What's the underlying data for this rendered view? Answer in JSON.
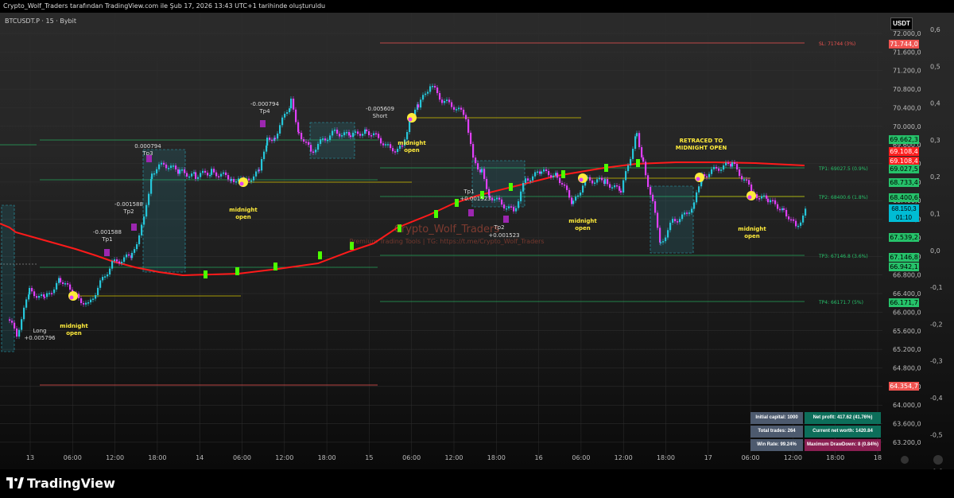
{
  "header": {
    "title": "Crypto_Wolf_Traders tarafından TradingView.com ile Şub 17, 2026 13:43 UTC+1 tarihinde oluşturuldu"
  },
  "symbol": "BTCUSDT.P · 15 · Bybit",
  "currency_button": "USDT",
  "price_axis": [
    "72.000,0",
    "71.600,0",
    "71.200,0",
    "70.800,0",
    "70.400,0",
    "70.000,0",
    "69.600,0",
    "69.200,0",
    "68.800,0",
    "68.400,0",
    "68.000,0",
    "67.600,0",
    "67.200,0",
    "66.800,0",
    "66.400,0",
    "66.000,0",
    "65.600,0",
    "65.200,0",
    "64.800,0",
    "64.400,0",
    "64.000,0",
    "63.600,0",
    "63.200,0"
  ],
  "pct_axis": [
    "0,6",
    "0,5",
    "0,4",
    "0,3",
    "0,2",
    "0,1",
    "0,0",
    "-0,1",
    "-0,2",
    "-0,3",
    "-0,4",
    "-0,5",
    "-0,6"
  ],
  "time_axis": [
    "13",
    "06:00",
    "12:00",
    "18:00",
    "14",
    "06:00",
    "12:00",
    "18:00",
    "15",
    "06:00",
    "12:00",
    "18:00",
    "16",
    "06:00",
    "12:00",
    "18:00",
    "17",
    "06:00",
    "12:00",
    "18:00",
    "18"
  ],
  "price_tags": [
    {
      "label": "71.744,0",
      "color": "#ef5350",
      "text": "#fff"
    },
    {
      "label": "69.662,3",
      "color": "#26c26a",
      "text": "#000"
    },
    {
      "label": "69.108,4",
      "color": "#ff2020",
      "text": "#fff"
    },
    {
      "label": "69.108,4",
      "color": "#ff2020",
      "text": "#fff"
    },
    {
      "label": "69.027,5",
      "color": "#26c26a",
      "text": "#000"
    },
    {
      "label": "68.733,4",
      "color": "#26c26a",
      "text": "#000"
    },
    {
      "label": "68.400,6",
      "color": "#26c26a",
      "text": "#000"
    },
    {
      "label": "67.539,2",
      "color": "#26c26a",
      "text": "#000"
    },
    {
      "label": "67.146,8",
      "color": "#26c26a",
      "text": "#000"
    },
    {
      "label": "66.942,1",
      "color": "#26c26a",
      "text": "#000"
    },
    {
      "label": "66.171,7",
      "color": "#26c26a",
      "text": "#000"
    },
    {
      "label": "64.354,7",
      "color": "#ef5350",
      "text": "#fff"
    }
  ],
  "current_price": {
    "price": "68.150,3",
    "countdown": "01:10"
  },
  "levels": [
    {
      "label": "SL: 71744 (3%)",
      "color": "#ef5350"
    },
    {
      "label": "TP1: 69027.5 (0.9%)",
      "color": "#26c26a"
    },
    {
      "label": "TP2: 68400.6 (1.8%)",
      "color": "#26c26a"
    },
    {
      "label": "TP3: 67146.8 (3.6%)",
      "color": "#26c26a"
    },
    {
      "label": "TP4: 66171.7 (5%)",
      "color": "#26c26a"
    }
  ],
  "annotations": {
    "midnight_open": "midnight\nopen",
    "retraced": [
      "RETRACED TO",
      "MIDNIGHT OPEN"
    ],
    "long_label": "Long",
    "long_value": "+0.005796",
    "short_label": "Short",
    "short_value": "-0.005609",
    "tp_labels": [
      "-0.001588",
      "Tp1",
      "-0.001588",
      "Tp2",
      "0.000794",
      "Tp3",
      "-0.000794",
      "Tp4",
      "Tp1",
      "+0.001523",
      "Tp2",
      "+0.001523"
    ]
  },
  "watermark": {
    "name": "Crypto_Wolf_Traders",
    "tagline": "Premium Trading Tools | TG: https://t.me/Crypto_Wolf_Traders"
  },
  "stats": {
    "initial_capital": "Initial capital: 1000",
    "net_profit": "Net profit: 417.62 (41.76%)",
    "total_trades": "Total trades: 264",
    "net_worth": "Current net worth: 1420.84",
    "win_rate": "Win Rate: 99.24%",
    "drawdown": "Maximum DrawDown: 8 (0.84%)"
  },
  "footer": {
    "brand": "TradingView"
  },
  "colors": {
    "bull": "#26c6da",
    "bear": "#e040fb",
    "supertrend_bear": "#ff1a1a",
    "supertrend_bull": "#4cff00",
    "midnight": "#ffeb3b"
  }
}
